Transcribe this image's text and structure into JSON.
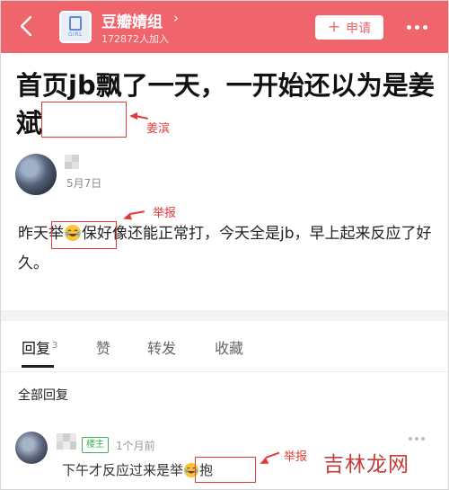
{
  "header": {
    "group_icon_text": "GIRL",
    "group_name": "豆瓣婧组",
    "members": "172872人加入",
    "apply_label": "申请"
  },
  "post": {
    "title": "首页jb飘了一天，一开始还以为是姜斌",
    "date": "5月7日",
    "body_part1": "昨天举",
    "body_part2": "保好像还能正常打，今天全是jb，早上起来反应了好久。"
  },
  "annotations": {
    "name_note": "姜滨",
    "report_note": "举报",
    "report_note_2": "举报"
  },
  "tabs": [
    {
      "label": "回复",
      "count": "3"
    },
    {
      "label": "赞"
    },
    {
      "label": "转发"
    },
    {
      "label": "收藏"
    }
  ],
  "replies": {
    "section_title": "全部回复",
    "first": {
      "badge": "楼主",
      "time": "1个月前",
      "text_part1": "下午才反应过来是举",
      "text_part2": "抱"
    }
  },
  "watermark": "吉林龙网",
  "colors": {
    "header_bg": "#f0646b",
    "annotation_red": "#e03a3a",
    "op_badge_green": "#3fae5a"
  }
}
